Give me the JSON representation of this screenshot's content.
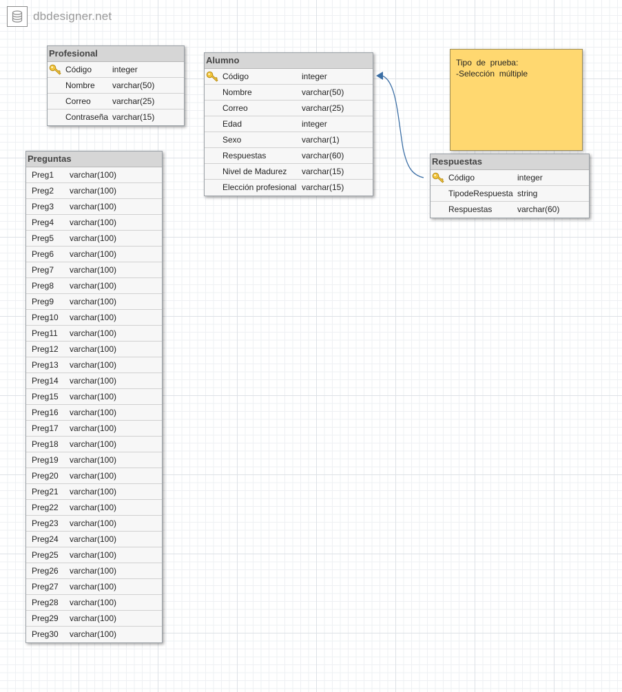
{
  "app": {
    "logo_text": "dbdesigner.net",
    "icon": "database-icon"
  },
  "tables": {
    "profesional": {
      "title": "Profesional",
      "rows": [
        {
          "name": "Código",
          "type": "integer",
          "pk": true
        },
        {
          "name": "Nombre",
          "type": "varchar(50)"
        },
        {
          "name": "Correo",
          "type": "varchar(25)"
        },
        {
          "name": "Contraseña",
          "type": "varchar(15)"
        }
      ]
    },
    "alumno": {
      "title": "Alumno",
      "rows": [
        {
          "name": "Código",
          "type": "integer",
          "pk": true
        },
        {
          "name": "Nombre",
          "type": "varchar(50)"
        },
        {
          "name": "Correo",
          "type": "varchar(25)"
        },
        {
          "name": "Edad",
          "type": "integer"
        },
        {
          "name": "Sexo",
          "type": "varchar(1)"
        },
        {
          "name": "Respuestas",
          "type": "varchar(60)"
        },
        {
          "name": "Nivel de Madurez",
          "type": "varchar(15)"
        },
        {
          "name": "Elección profesional",
          "type": "varchar(15)"
        }
      ]
    },
    "respuestas": {
      "title": "Respuestas",
      "rows": [
        {
          "name": "Código",
          "type": "integer",
          "pk": true
        },
        {
          "name": "TipodeRespuesta",
          "type": "string"
        },
        {
          "name": "Respuestas",
          "type": "varchar(60)"
        }
      ]
    },
    "preguntas": {
      "title": "Preguntas",
      "rows": [
        {
          "name": "Preg1",
          "type": "varchar(100)"
        },
        {
          "name": "Preg2",
          "type": "varchar(100)"
        },
        {
          "name": "Preg3",
          "type": "varchar(100)"
        },
        {
          "name": "Preg4",
          "type": "varchar(100)"
        },
        {
          "name": "Preg5",
          "type": "varchar(100)"
        },
        {
          "name": "Preg6",
          "type": "varchar(100)"
        },
        {
          "name": "Preg7",
          "type": "varchar(100)"
        },
        {
          "name": "Preg8",
          "type": "varchar(100)"
        },
        {
          "name": "Preg9",
          "type": "varchar(100)"
        },
        {
          "name": "Preg10",
          "type": "varchar(100)"
        },
        {
          "name": "Preg11",
          "type": "varchar(100)"
        },
        {
          "name": "Preg12",
          "type": "varchar(100)"
        },
        {
          "name": "Preg13",
          "type": "varchar(100)"
        },
        {
          "name": "Preg14",
          "type": "varchar(100)"
        },
        {
          "name": "Preg15",
          "type": "varchar(100)"
        },
        {
          "name": "Preg16",
          "type": "varchar(100)"
        },
        {
          "name": "Preg17",
          "type": "varchar(100)"
        },
        {
          "name": "Preg18",
          "type": "varchar(100)"
        },
        {
          "name": "Preg19",
          "type": "varchar(100)"
        },
        {
          "name": "Preg20",
          "type": "varchar(100)"
        },
        {
          "name": "Preg21",
          "type": "varchar(100)"
        },
        {
          "name": "Preg22",
          "type": "varchar(100)"
        },
        {
          "name": "Preg23",
          "type": "varchar(100)"
        },
        {
          "name": "Preg24",
          "type": "varchar(100)"
        },
        {
          "name": "Preg25",
          "type": "varchar(100)"
        },
        {
          "name": "Preg26",
          "type": "varchar(100)"
        },
        {
          "name": "Preg27",
          "type": "varchar(100)"
        },
        {
          "name": "Preg28",
          "type": "varchar(100)"
        },
        {
          "name": "Preg29",
          "type": "varchar(100)"
        },
        {
          "name": "Preg30",
          "type": "varchar(100)"
        }
      ]
    }
  },
  "note": {
    "lines": [
      "Tipo  de  prueba:",
      "-Selección  múltiple"
    ]
  },
  "relationship": {
    "from": "Respuestas",
    "to": "Alumno",
    "color": "#3a6ea5"
  },
  "colors": {
    "note_bg": "#ffd870",
    "header_bg": "#d6d6d6",
    "key_color": "#f2c43a"
  }
}
